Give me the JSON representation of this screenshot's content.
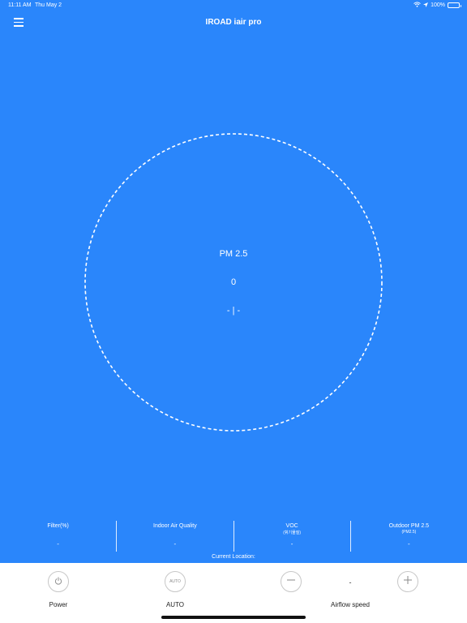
{
  "status_bar": {
    "time": "11:11 AM",
    "date": "Thu May 2",
    "battery": "100%"
  },
  "header": {
    "title": "IROAD iair pro",
    "menu_icon": "hamburger-menu-icon"
  },
  "gauge": {
    "title": "PM 2.5",
    "value": "0",
    "status": "- | -"
  },
  "stats": [
    {
      "label": "Filter(%)",
      "sub": "",
      "value": "-"
    },
    {
      "label": "Indoor Air Quality",
      "sub": "",
      "value": "-"
    },
    {
      "label": "VOC",
      "sub": "(휘기물질)",
      "value": "-"
    },
    {
      "label": "Outdoor PM 2.5",
      "sub": "(PM2.5)",
      "value": "-"
    }
  ],
  "location": {
    "label": "Current Location:"
  },
  "controls": {
    "power_label": "Power",
    "auto_button_text": "AUTO",
    "auto_label": "AUTO",
    "speed_value": "-",
    "airflow_label": "Airflow speed"
  },
  "colors": {
    "background": "#2a86fb",
    "panel": "#ffffff"
  }
}
